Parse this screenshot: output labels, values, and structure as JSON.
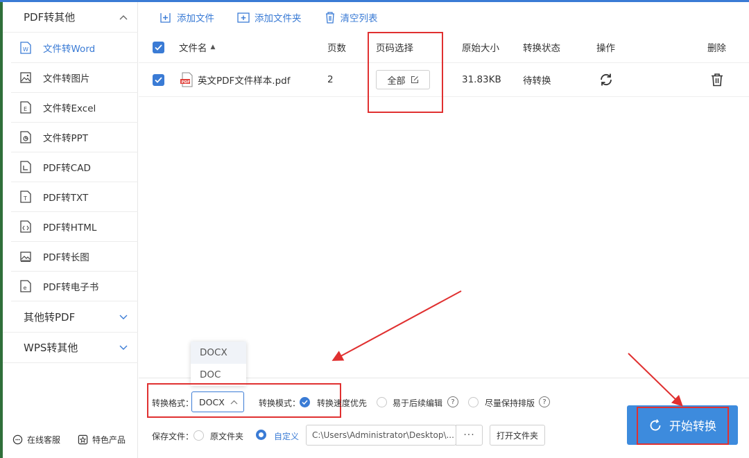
{
  "sidebar": {
    "groups": [
      {
        "label": "PDF转其他",
        "expanded": true
      },
      {
        "label": "其他转PDF",
        "expanded": false
      },
      {
        "label": "WPS转其他",
        "expanded": false
      }
    ],
    "items": [
      {
        "label": "文件转Word",
        "icon": "word-file-icon",
        "active": true
      },
      {
        "label": "文件转图片",
        "icon": "image-file-icon"
      },
      {
        "label": "文件转Excel",
        "icon": "excel-file-icon"
      },
      {
        "label": "文件转PPT",
        "icon": "ppt-file-icon"
      },
      {
        "label": "PDF转CAD",
        "icon": "cad-file-icon"
      },
      {
        "label": "PDF转TXT",
        "icon": "txt-file-icon"
      },
      {
        "label": "PDF转HTML",
        "icon": "html-file-icon"
      },
      {
        "label": "PDF转长图",
        "icon": "long-image-icon"
      },
      {
        "label": "PDF转电子书",
        "icon": "ebook-file-icon"
      }
    ],
    "footer": {
      "service": "在线客服",
      "products": "特色产品"
    }
  },
  "toolbar": {
    "add_file": "添加文件",
    "add_folder": "添加文件夹",
    "clear_list": "清空列表"
  },
  "table": {
    "headers": {
      "filename": "文件名",
      "pages": "页数",
      "page_select": "页码选择",
      "size": "原始大小",
      "status": "转换状态",
      "action": "操作",
      "delete": "删除"
    },
    "rows": [
      {
        "checked": true,
        "filename": "英文PDF文件样本.pdf",
        "pages": "2",
        "page_select": "全部",
        "size": "31.83KB",
        "status": "待转换"
      }
    ]
  },
  "options": {
    "format_label": "转换格式：",
    "format_value": "DOCX",
    "format_options": [
      "DOCX",
      "DOC"
    ],
    "mode_label": "转换模式：",
    "modes": [
      {
        "label": "转换速度优先",
        "selected": true
      },
      {
        "label": "易于后续编辑",
        "selected": false
      },
      {
        "label": "尽量保持排版",
        "selected": false
      }
    ],
    "save_label": "保存文件：",
    "save_original": "原文件夹",
    "save_custom": "自定义",
    "save_path": "C:\\Users\\Administrator\\Desktop\\...",
    "browse": "···",
    "open_folder": "打开文件夹"
  },
  "start_button": "开始转换",
  "colors": {
    "accent": "#3a7bd5",
    "start_button": "#3d8bdd",
    "annotation": "#e03030"
  }
}
